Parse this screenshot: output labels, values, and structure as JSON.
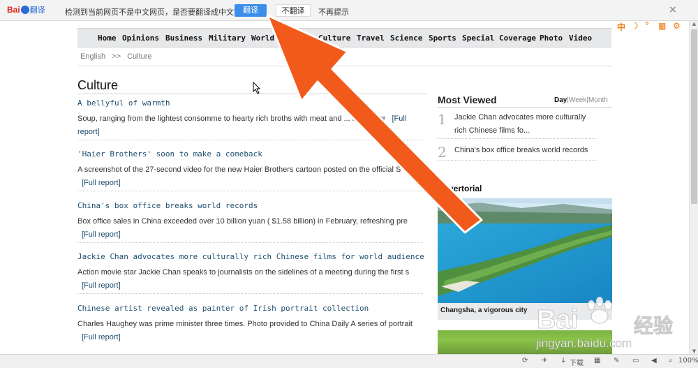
{
  "translate_bar": {
    "logo_brand": "Bai",
    "logo_sub": "翻译",
    "message": "检测到当前网页不是中文网页，是否要翻译成中文？",
    "translate_label": "翻译",
    "no_translate_label": "不翻译",
    "never_label": "不再提示",
    "close_label": "×"
  },
  "toolbar_icons": [
    "中",
    "☽",
    "°",
    "▦",
    "⚙"
  ],
  "nav": {
    "items": [
      "Home",
      "Opinions",
      "Business",
      "Military",
      "World",
      "Culture",
      "Travel",
      "Science",
      "Sports",
      "Special Coverage",
      "Photo",
      "Video"
    ]
  },
  "breadcrumb": {
    "root": "English",
    "sep": ">>",
    "current": "Culture"
  },
  "section_title": "Culture",
  "articles": [
    {
      "title": "A bellyful of warmth",
      "desc": "Soup, ranging from the lightest consomme to hearty rich broths with meat and ... is a major",
      "full": "[Full report]"
    },
    {
      "title": "'Haier Brothers' soon to make a comeback",
      "desc": "A screenshot of the 27-second video for the new Haier Brothers cartoon posted on the official S W",
      "full": "[Full report]"
    },
    {
      "title": "China's box office breaks world records",
      "desc": "Box office sales in China exceeded over 10 billion yuan ( $1.58 billion) in February, refreshing pre",
      "full": "[Full report]"
    },
    {
      "title": "Jackie Chan advocates more culturally rich Chinese films for world audience",
      "desc": "Action movie star Jackie Chan speaks to journalists on the sidelines of a meeting during the first s",
      "full": "[Full report]"
    },
    {
      "title": "Chinese artist revealed as painter of Irish portrait collection",
      "desc": "Charles Haughey was prime minister three times. Photo provided to China Daily A series of portrait",
      "full": "[Full report]"
    }
  ],
  "most_viewed": {
    "title": "Most Viewed",
    "tabs": [
      "Day",
      "Week",
      "Month"
    ],
    "items": [
      {
        "num": "1",
        "text": "Jackie Chan advocates more culturally rich Chinese films fo..."
      },
      {
        "num": "2",
        "text": "China's box office breaks world records"
      }
    ]
  },
  "advertorial": {
    "title": "Advertorial",
    "caption": "Changsha, a vigorous city"
  },
  "watermark": {
    "brand": "Bai",
    "brand_cn": "经验",
    "url": "jingyan.baidu.com"
  },
  "status_bar": {
    "download": "下载",
    "zoom": "100%"
  },
  "colors": {
    "accent_orange": "#f25a1c",
    "link": "#1e4f6f",
    "translate_blue": "#3b8eea"
  }
}
